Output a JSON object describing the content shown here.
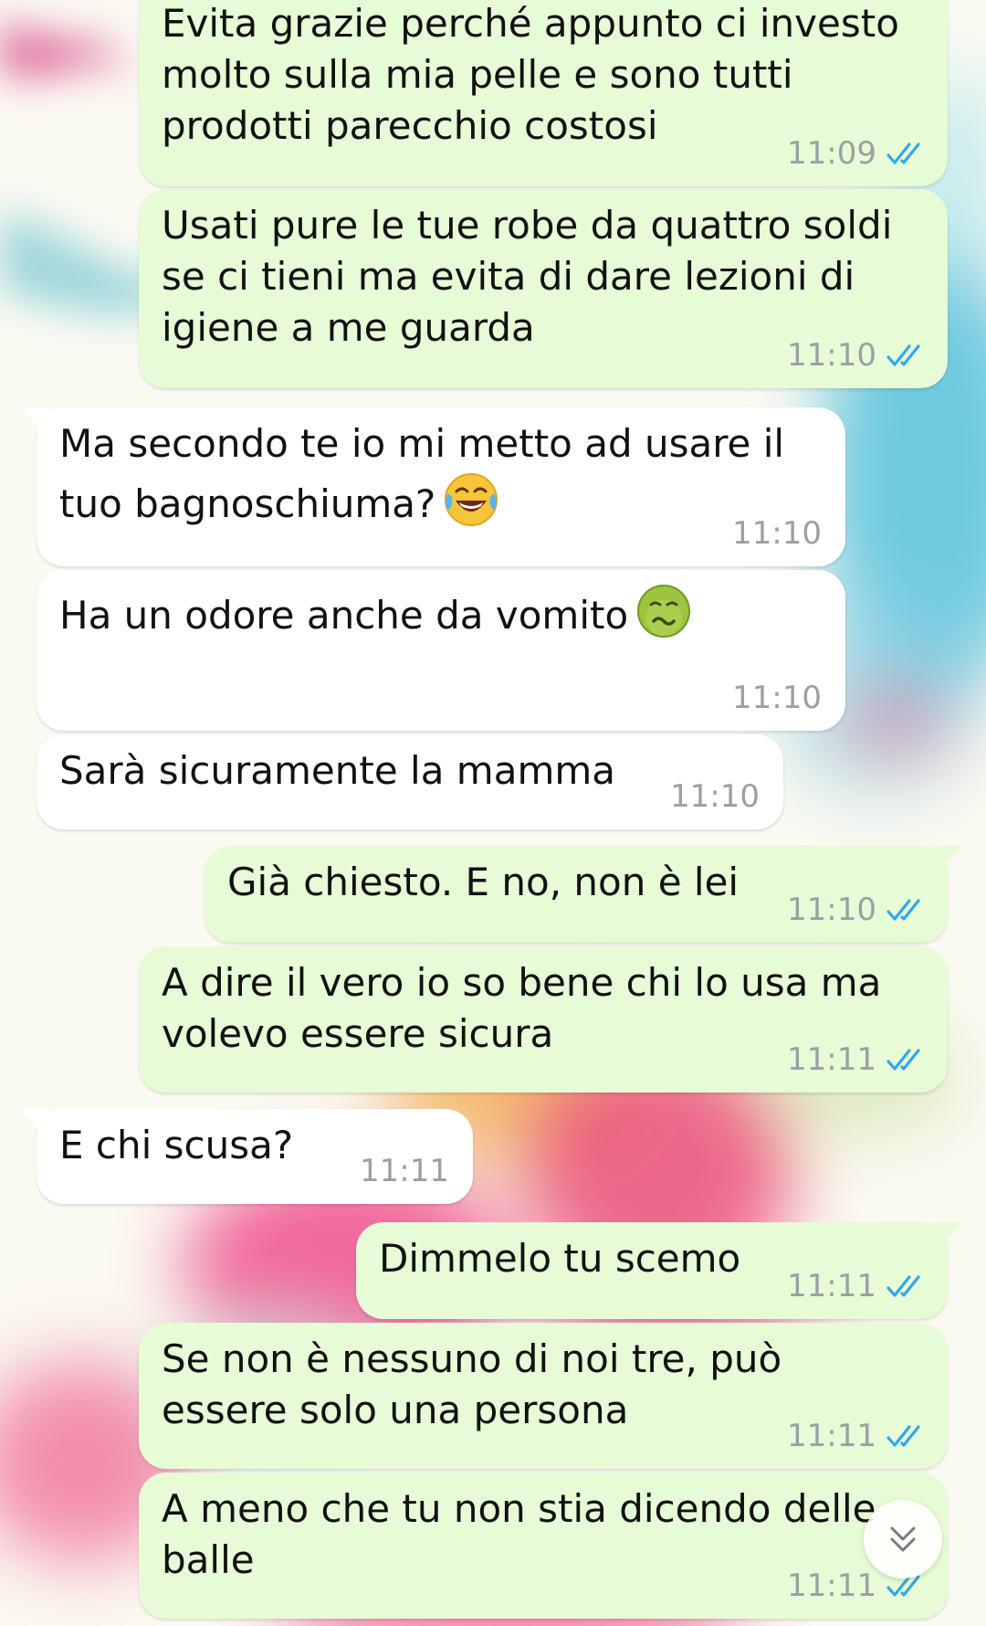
{
  "colors": {
    "outgoing_bubble": "#e6fbd6",
    "incoming_bubble": "#ffffff",
    "timestamp": "#9aa0a3",
    "read_ticks": "#34a7e8"
  },
  "messages": [
    {
      "direction": "outgoing",
      "text": "Evita grazie perché appunto ci investo\nmolto sulla mia pelle e sono tutti\nprodotti parecchio costosi",
      "time": "11:09",
      "status": "read"
    },
    {
      "direction": "outgoing",
      "text": "Usati pure le tue robe da quattro soldi\nse ci tieni ma evita di dare lezioni di\nigiene a me guarda",
      "time": "11:10",
      "status": "read"
    },
    {
      "direction": "incoming",
      "text": "Ma secondo te io mi metto ad usare il\ntuo bagnoschiuma?",
      "emoji": "face-with-tears-of-joy-emoji",
      "time": "11:10"
    },
    {
      "direction": "incoming",
      "text": "Ha un odore anche da vomito",
      "emoji": "nauseated-face-emoji",
      "time": "11:10"
    },
    {
      "direction": "incoming",
      "text": "Sarà sicuramente la mamma",
      "time": "11:10"
    },
    {
      "direction": "outgoing",
      "text": "Già chiesto. E no, non è lei",
      "time": "11:10",
      "status": "read"
    },
    {
      "direction": "outgoing",
      "text": "A dire il vero io so bene chi lo usa ma\nvolevo essere sicura",
      "time": "11:11",
      "status": "read"
    },
    {
      "direction": "incoming",
      "text": "E chi scusa?",
      "time": "11:11"
    },
    {
      "direction": "outgoing",
      "text": "Dimmelo tu scemo",
      "time": "11:11",
      "status": "read"
    },
    {
      "direction": "outgoing",
      "text": "Se non è nessuno di noi tre, può\nessere solo una persona",
      "time": "11:11",
      "status": "read"
    },
    {
      "direction": "outgoing",
      "text": "A meno che tu non stia dicendo delle\nballe",
      "time": "11:11",
      "status": "read"
    }
  ],
  "scroll_button": {
    "icon": "double-chevron-down-icon"
  }
}
